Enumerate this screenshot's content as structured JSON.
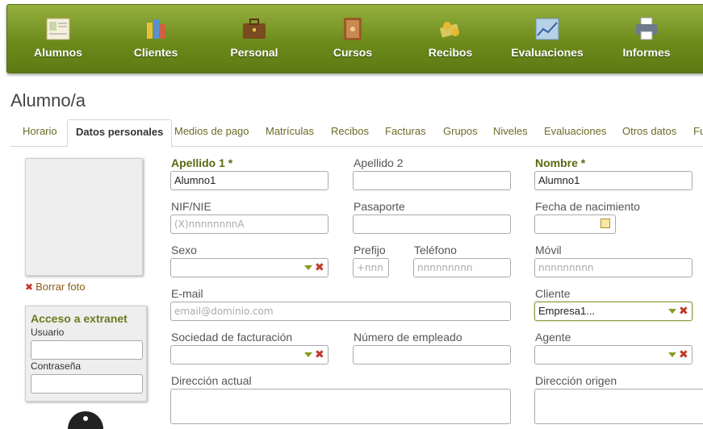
{
  "nav": {
    "items": [
      {
        "label": "Alumnos",
        "icon": "student-card-icon"
      },
      {
        "label": "Clientes",
        "icon": "clients-icon"
      },
      {
        "label": "Personal",
        "icon": "briefcase-icon"
      },
      {
        "label": "Cursos",
        "icon": "book-icon"
      },
      {
        "label": "Recibos",
        "icon": "money-icon"
      },
      {
        "label": "Evaluaciones",
        "icon": "chart-icon"
      },
      {
        "label": "Informes",
        "icon": "printer-icon"
      }
    ]
  },
  "page": {
    "title": "Alumno/a"
  },
  "tabs": [
    "Horario",
    "Datos personales",
    "Medios de pago",
    "Matrículas",
    "Recibos",
    "Facturas",
    "Grupos",
    "Niveles",
    "Evaluaciones",
    "Otros datos",
    "Fu"
  ],
  "photo": {
    "delete_label": "Borrar foto"
  },
  "extranet": {
    "title": "Acceso a extranet",
    "user_label": "Usuario",
    "password_label": "Contraseña"
  },
  "form": {
    "apellido1": {
      "label": "Apellido 1 *",
      "value": "Alumno1"
    },
    "apellido2": {
      "label": "Apellido 2",
      "value": ""
    },
    "nombre": {
      "label": "Nombre *",
      "value": "Alumno1"
    },
    "nif": {
      "label": "NIF/NIE",
      "placeholder": "(X)nnnnnnnnA"
    },
    "pasaporte": {
      "label": "Pasaporte",
      "value": ""
    },
    "fecha_nacimiento": {
      "label": "Fecha de nacimiento",
      "value": ""
    },
    "sexo": {
      "label": "Sexo",
      "value": ""
    },
    "prefijo": {
      "label": "Prefijo",
      "placeholder": "+nnn"
    },
    "telefono": {
      "label": "Teléfono",
      "placeholder": "nnnnnnnnn"
    },
    "movil": {
      "label": "Móvil",
      "placeholder": "nnnnnnnnn"
    },
    "email": {
      "label": "E-mail",
      "placeholder": "email@dominio.com"
    },
    "cliente": {
      "label": "Cliente",
      "value": "Empresa1..."
    },
    "sociedad": {
      "label": "Sociedad de facturación",
      "value": ""
    },
    "num_empleado": {
      "label": "Número de empleado",
      "value": ""
    },
    "agente": {
      "label": "Agente",
      "value": ""
    },
    "direccion_actual": {
      "label": "Dirección actual"
    },
    "direccion_origen": {
      "label": "Dirección origen"
    }
  },
  "colors": {
    "nav_green": "#7a9626",
    "required_label": "#5a6a10",
    "clear_red": "#c0392b"
  }
}
